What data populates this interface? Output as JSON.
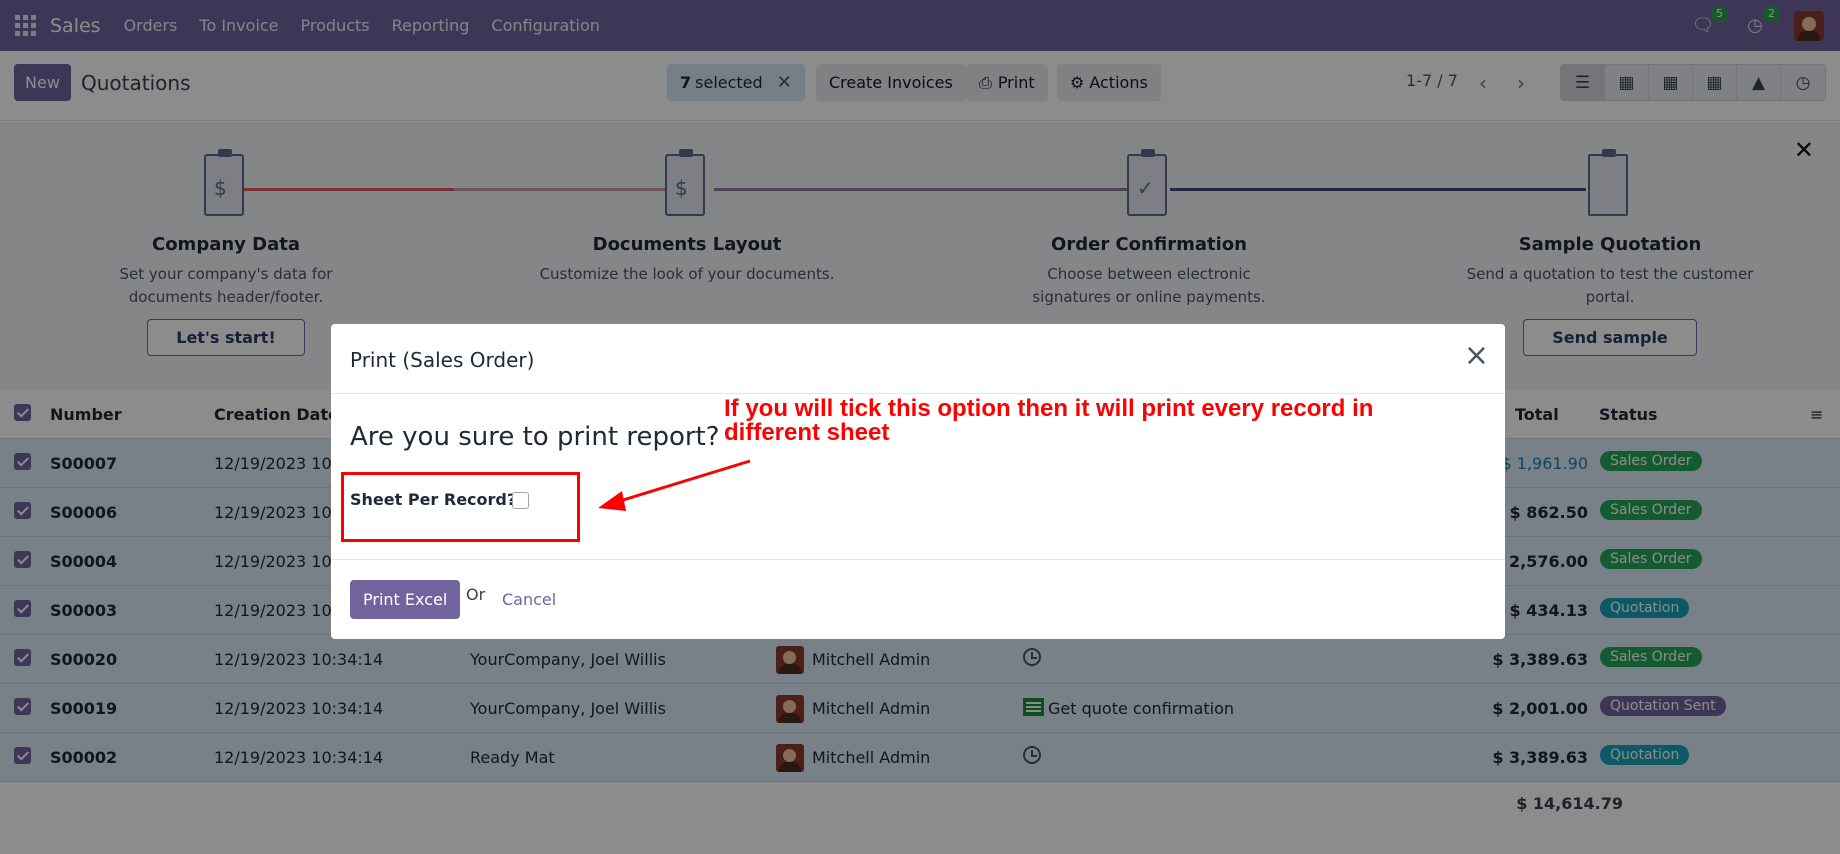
{
  "navbar": {
    "brand": "Sales",
    "menu": [
      "Orders",
      "To Invoice",
      "Products",
      "Reporting",
      "Configuration"
    ],
    "messages_count": "5",
    "activities_count": "2"
  },
  "control_panel": {
    "new_label": "New",
    "title": "Quotations",
    "selected_count": "7",
    "selected_label": "selected",
    "create_invoices": "Create Invoices",
    "print": "Print",
    "actions": "Actions",
    "pager": "1-7 / 7"
  },
  "onboarding": {
    "steps": [
      {
        "title": "Company Data",
        "desc": "Set your company's data for documents header/footer.",
        "button": "Let's start!"
      },
      {
        "title": "Documents Layout",
        "desc": "Customize the look of your documents.",
        "button": ""
      },
      {
        "title": "Order Confirmation",
        "desc": "Choose between electronic signatures or online payments.",
        "button": ""
      },
      {
        "title": "Sample Quotation",
        "desc": "Send a quotation to test the customer portal.",
        "button": "Send sample"
      }
    ]
  },
  "table": {
    "headers": {
      "number": "Number",
      "creation_date": "Creation Date",
      "total": "Total",
      "status": "Status"
    },
    "rows": [
      {
        "number": "S00007",
        "date": "12/19/2023 10:",
        "customer": "",
        "salesperson": "",
        "activity": "",
        "total": "$ 1,961.90",
        "status": "Sales Order"
      },
      {
        "number": "S00006",
        "date": "12/19/2023 10:",
        "customer": "",
        "salesperson": "",
        "activity": "",
        "total": "$ 862.50",
        "status": "Sales Order"
      },
      {
        "number": "S00004",
        "date": "12/19/2023 10:",
        "customer": "",
        "salesperson": "",
        "activity": "",
        "total": "$ 2,576.00",
        "status": "Sales Order"
      },
      {
        "number": "S00003",
        "date": "12/19/2023 10:",
        "customer": "",
        "salesperson": "",
        "activity": "",
        "total": "$ 434.13",
        "status": "Quotation"
      },
      {
        "number": "S00020",
        "date": "12/19/2023 10:34:14",
        "customer": "YourCompany, Joel Willis",
        "salesperson": "Mitchell Admin",
        "activity": "",
        "total": "$ 3,389.63",
        "status": "Sales Order"
      },
      {
        "number": "S00019",
        "date": "12/19/2023 10:34:14",
        "customer": "YourCompany, Joel Willis",
        "salesperson": "Mitchell Admin",
        "activity": "Get quote confirmation",
        "total": "$ 2,001.00",
        "status": "Quotation Sent"
      },
      {
        "number": "S00002",
        "date": "12/19/2023 10:34:14",
        "customer": "Ready Mat",
        "salesperson": "Mitchell Admin",
        "activity": "",
        "total": "$ 3,389.63",
        "status": "Quotation"
      }
    ],
    "grand_total": "$ 14,614.79"
  },
  "modal": {
    "title": "Print (Sales Order)",
    "question": "Are you sure to print report?",
    "field_label": "Sheet Per Record?",
    "print_button": "Print Excel",
    "or": "Or",
    "cancel": "Cancel"
  },
  "annotation": "If you will tick this option then it will print every record in different sheet"
}
